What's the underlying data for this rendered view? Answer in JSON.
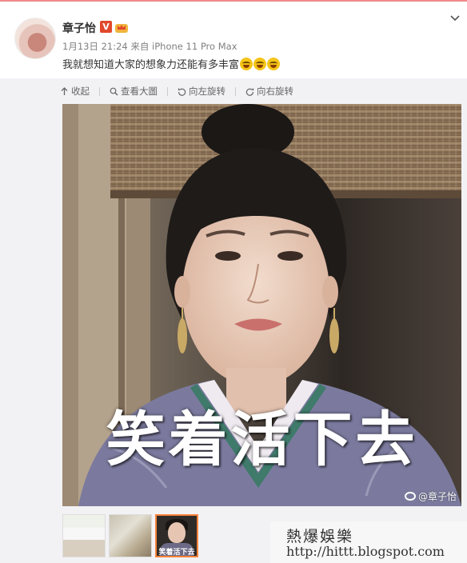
{
  "post": {
    "author": "章子怡",
    "vip_badge": "V",
    "meta": "1月13日 21:24 来自 iPhone 11 Pro Max",
    "text": "我就想知道大家的想象力还能有多丰富",
    "emoji": [
      "laugh-cry-emoji",
      "laugh-cry-emoji",
      "laugh-cry-emoji"
    ]
  },
  "toolbar": {
    "collapse": "收起",
    "view_large": "查看大圖",
    "rotate_left": "向左旋转",
    "rotate_right": "向右旋转"
  },
  "image": {
    "caption": "笑着活下去",
    "watermark": "@章子怡"
  },
  "thumbnails": [
    "thumbnail-1",
    "thumbnail-2",
    "thumbnail-3-selected"
  ],
  "thumbnail_caption": "笑着活下去",
  "blog": {
    "title": "熱爆娛樂",
    "url": "http://hittt.blogspot.com"
  },
  "colors": {
    "vip_badge": "#e1482b",
    "selected_thumb_border": "#f7843b",
    "panel_bg": "#f2f2f5"
  }
}
